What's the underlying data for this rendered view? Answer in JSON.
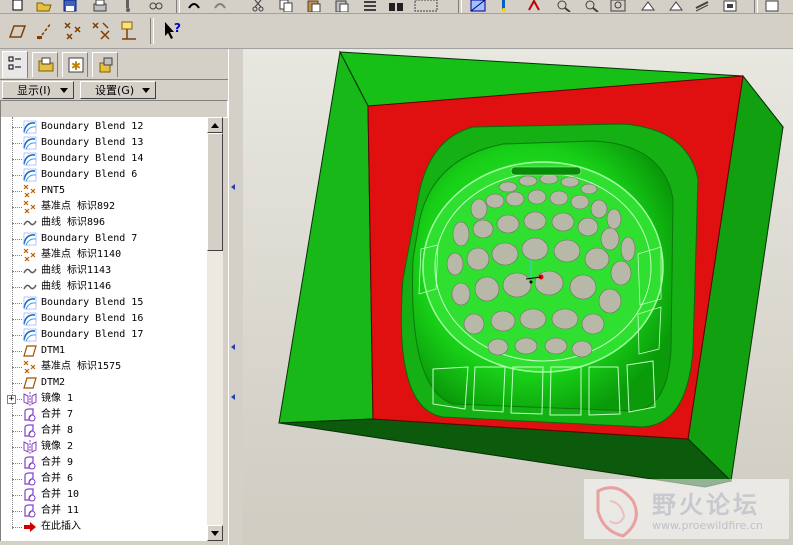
{
  "panel": {
    "show_menu": "显示(I)",
    "settings_menu": "设置(G)"
  },
  "tree": {
    "items": [
      {
        "label": "Boundary Blend 12",
        "icon": "boundary-blend-icon"
      },
      {
        "label": "Boundary Blend 13",
        "icon": "boundary-blend-icon"
      },
      {
        "label": "Boundary Blend 14",
        "icon": "boundary-blend-icon"
      },
      {
        "label": "Boundary Blend 6",
        "icon": "boundary-blend-icon"
      },
      {
        "label": "PNT5",
        "icon": "datum-point-icon"
      },
      {
        "label": "基准点 标识892",
        "icon": "datum-point-icon"
      },
      {
        "label": "曲线 标识896",
        "icon": "curve-icon"
      },
      {
        "label": "Boundary Blend 7",
        "icon": "boundary-blend-icon"
      },
      {
        "label": "基准点 标识1140",
        "icon": "datum-point-icon"
      },
      {
        "label": "曲线 标识1143",
        "icon": "curve-icon"
      },
      {
        "label": "曲线 标识1146",
        "icon": "curve-icon"
      },
      {
        "label": "Boundary Blend 15",
        "icon": "boundary-blend-icon"
      },
      {
        "label": "Boundary Blend 16",
        "icon": "boundary-blend-icon"
      },
      {
        "label": "Boundary Blend 17",
        "icon": "boundary-blend-icon"
      },
      {
        "label": "DTM1",
        "icon": "datum-plane-icon"
      },
      {
        "label": "基准点 标识1575",
        "icon": "datum-point-icon"
      },
      {
        "label": "DTM2",
        "icon": "datum-plane-icon"
      },
      {
        "label": "镜像 1",
        "icon": "mirror-icon",
        "expandable": true
      },
      {
        "label": "合并 7",
        "icon": "merge-icon"
      },
      {
        "label": "合并 8",
        "icon": "merge-icon"
      },
      {
        "label": "镜像 2",
        "icon": "mirror-icon"
      },
      {
        "label": "合并 9",
        "icon": "merge-icon"
      },
      {
        "label": "合并 6",
        "icon": "merge-icon"
      },
      {
        "label": "合并 10",
        "icon": "merge-icon"
      },
      {
        "label": "合并 11",
        "icon": "merge-icon"
      },
      {
        "label": "在此插入",
        "icon": "insert-here-arrow-icon"
      }
    ]
  },
  "watermark": {
    "title": "野火论坛",
    "url": "www.proewildfire.cn"
  },
  "colors": {
    "model_green": "#18c818",
    "cavity_red": "#e01010",
    "boss_green": "#30e830",
    "pad_gray": "#b8b8a8"
  }
}
